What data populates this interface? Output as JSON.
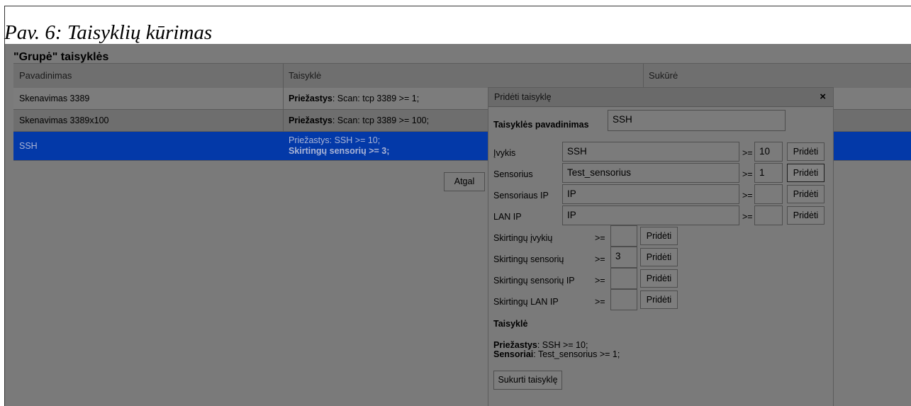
{
  "caption": "Pav. 6: Taisyklių kūrimas",
  "page": {
    "heading": "\"Grupė\" taisyklės",
    "columns": [
      "Pavadinimas",
      "Taisyklė",
      "Sukūrė"
    ],
    "rows": [
      {
        "name": "Skenavimas 3389",
        "rule_key": "Priežastys",
        "rule_rest": ": Scan: tcp 3389 >= 1;"
      },
      {
        "name": "Skenavimas 3389x100",
        "rule_key": "Priežastys",
        "rule_rest": ": Scan: tcp 3389 >= 100;"
      },
      {
        "name": "SSH",
        "rule_line1": "Priežastys: SSH >= 10;",
        "rule_line2": "Skirtingų sensorių >= 3;"
      }
    ],
    "back_label": "Atgal"
  },
  "modal": {
    "title": "Pridėti taisyklę",
    "close_glyph": "×",
    "name_label": "Taisyklės pavadinimas",
    "name_value": "SSH",
    "add_label": "Pridėti",
    "ge": ">=",
    "conditions": [
      {
        "label": "Įvykis",
        "value": "SSH",
        "count": "10"
      },
      {
        "label": "Sensorius",
        "value": "Test_sensorius",
        "count": "1"
      },
      {
        "label": "Sensoriaus IP",
        "value": "",
        "placeholder": "IP",
        "count": ""
      },
      {
        "label": "LAN IP",
        "value": "",
        "placeholder": "IP",
        "count": ""
      }
    ],
    "distinct": [
      {
        "label": "Skirtingų įvykių",
        "count": ""
      },
      {
        "label": "Skirtingų sensorių",
        "count": "3"
      },
      {
        "label": "Skirtingų sensorių IP",
        "count": ""
      },
      {
        "label": "Skirtingų LAN IP",
        "count": ""
      }
    ],
    "rule_heading": "Taisyklė",
    "summary": [
      {
        "key": "Priežastys",
        "rest": ": SSH >= 10;"
      },
      {
        "key": "Sensoriai",
        "rest": ": Test_sensorius >= 1;"
      }
    ],
    "create_label": "Sukurti taisyklę"
  }
}
